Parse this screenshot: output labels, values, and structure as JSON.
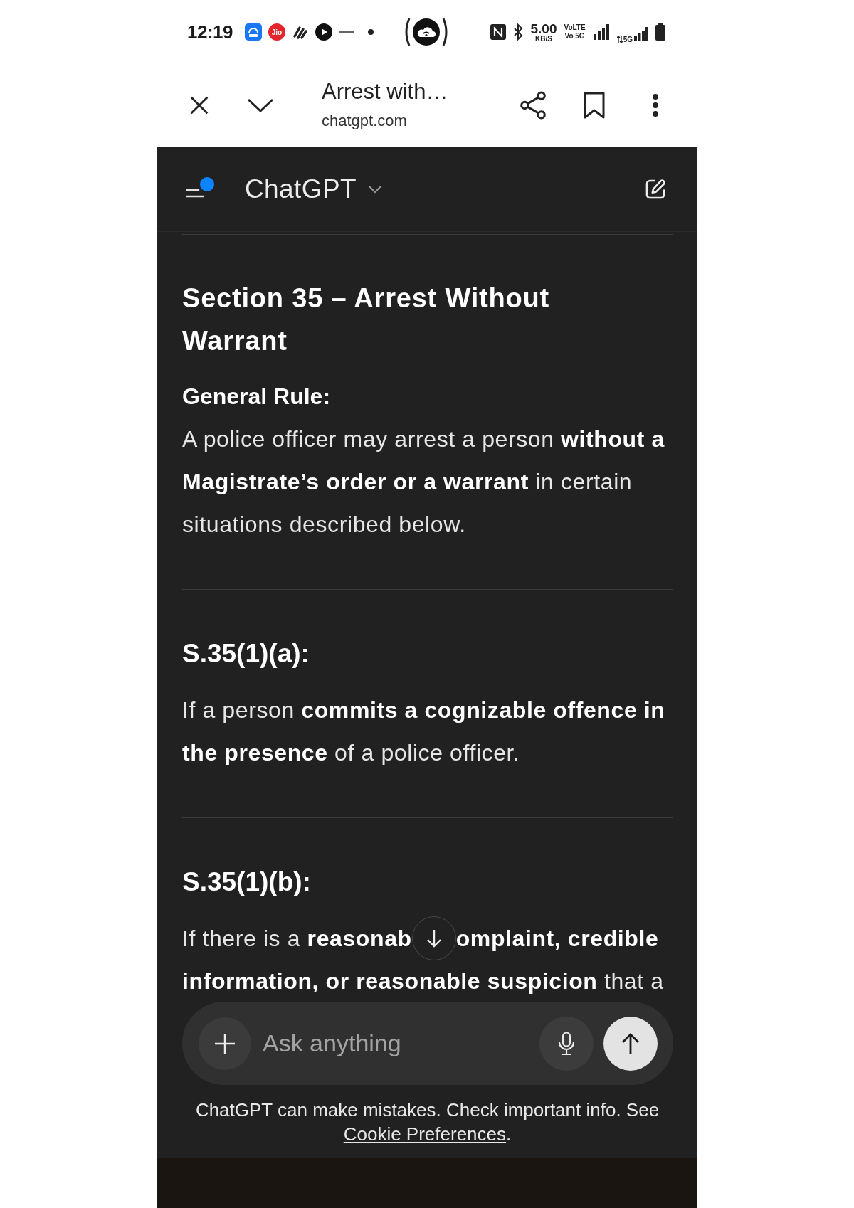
{
  "status_bar": {
    "time": "12:19",
    "app_badge": "Jio",
    "net_speed": "5.00",
    "net_speed_unit": "KB/S",
    "volte_top": "VoLTE",
    "volte_bottom": "Vo 5G",
    "network_type": "5G"
  },
  "browser_bar": {
    "title": "Arrest with…",
    "url": "chatgpt.com"
  },
  "chat_header": {
    "title": "ChatGPT",
    "sidebar_notification": true
  },
  "message": {
    "blocks": [
      {
        "kind": "rule"
      },
      {
        "kind": "heading",
        "text": "Section 35 – Arrest Without Warrant"
      },
      {
        "kind": "label",
        "text": "General Rule:"
      },
      {
        "kind": "paragraph",
        "text": "A police officer may arrest a person **without a Magistrate’s order or a warrant** in certain situations described below."
      },
      {
        "kind": "rule"
      },
      {
        "kind": "subheading",
        "text": "S.35(1)(a):"
      },
      {
        "kind": "paragraph",
        "text": "If a person **commits a cognizable offence in the presence** of a police officer."
      },
      {
        "kind": "rule"
      },
      {
        "kind": "subheading",
        "text": "S.35(1)(b):"
      },
      {
        "kind": "occluded_paragraph",
        "text_left_of_button": "If there is a **reasonab**",
        "text_right_of_button": "**omplaint, credible**",
        "text_next_line": "**information, or reasonable suspicion** that a"
      }
    ]
  },
  "composer": {
    "placeholder": "Ask anything"
  },
  "disclaimer": {
    "text": "ChatGPT can make mistakes. Check important info. See",
    "link": "Cookie Preferences",
    "end": "."
  }
}
